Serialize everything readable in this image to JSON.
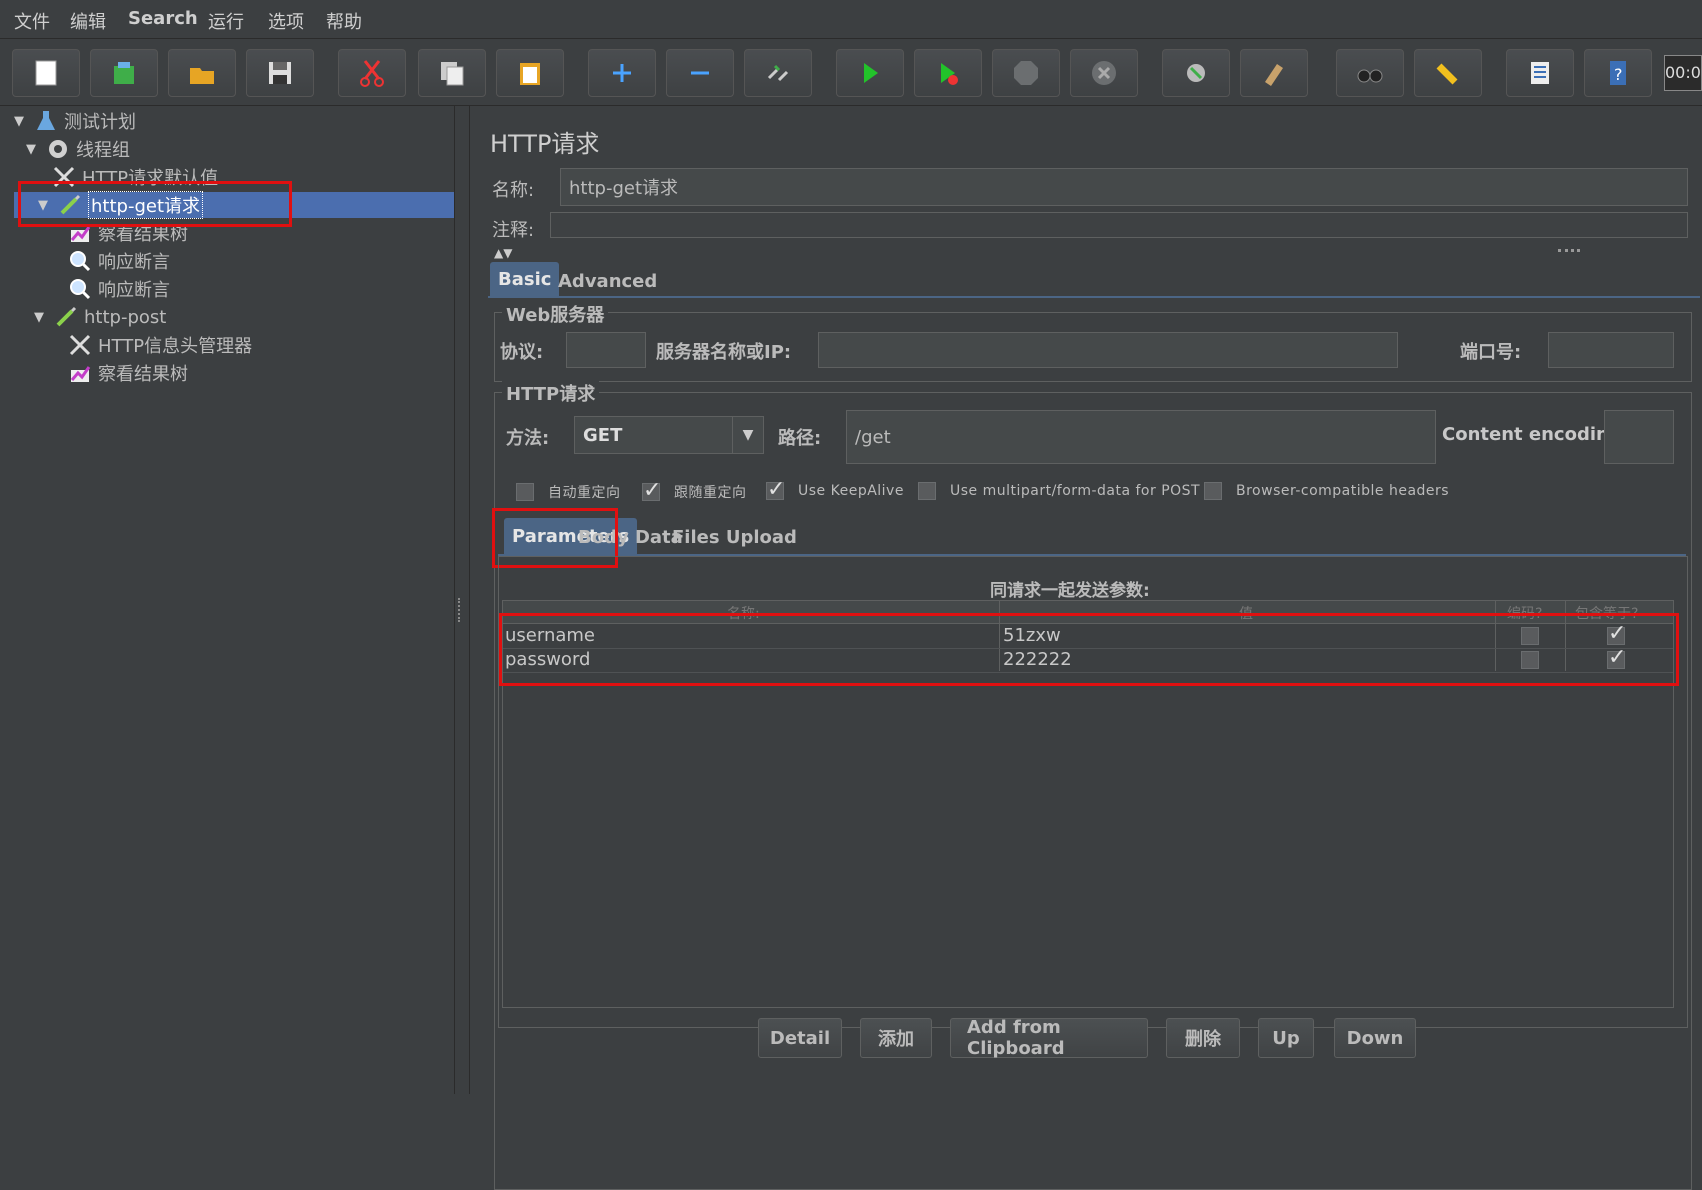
{
  "menu": [
    "文件",
    "编辑",
    "Search",
    "运行",
    "选项",
    "帮助"
  ],
  "toolbar": {
    "icons": [
      "new-icon",
      "templates-icon",
      "open-icon",
      "save-icon",
      "cut-icon",
      "copy-icon",
      "paste-icon",
      "expand-icon",
      "collapse-icon",
      "toggle-icon",
      "start-icon",
      "start-no-pause-icon",
      "stop-icon",
      "shutdown-icon",
      "clear-icon",
      "clear-all-icon",
      "search-icon",
      "reset-search-icon",
      "function-helper-icon",
      "help-icon"
    ],
    "timer": "00:0"
  },
  "tree": {
    "nodes": [
      {
        "label": "测试计划",
        "icon": "flask-icon"
      },
      {
        "label": "线程组",
        "icon": "gear-icon"
      },
      {
        "label": "HTTP请求默认值",
        "icon": "tools-icon"
      },
      {
        "label": "http-get请求",
        "icon": "pipette-icon"
      },
      {
        "label": "察看结果树",
        "icon": "chart-icon"
      },
      {
        "label": "响应断言",
        "icon": "magnifier-icon"
      },
      {
        "label": "响应断言",
        "icon": "magnifier-icon"
      },
      {
        "label": "http-post",
        "icon": "pipette-icon"
      },
      {
        "label": "HTTP信息头管理器",
        "icon": "tools-icon"
      },
      {
        "label": "察看结果树",
        "icon": "chart-icon"
      }
    ]
  },
  "panel": {
    "title": "HTTP请求",
    "name_label": "名称:",
    "name_value": "http-get请求",
    "comment_label": "注释:",
    "comment_value": "",
    "tabs": [
      "Basic",
      "Advanced"
    ],
    "web_server": {
      "title": "Web服务器",
      "protocol_label": "协议:",
      "protocol_value": "",
      "server_label": "服务器名称或IP:",
      "server_value": "",
      "port_label": "端口号:",
      "port_value": ""
    },
    "http_request": {
      "title": "HTTP请求",
      "method_label": "方法:",
      "method_value": "GET",
      "path_label": "路径:",
      "path_value": "/get",
      "encoding_label": "Content encoding:",
      "encoding_value": ""
    },
    "options": [
      {
        "label": "自动重定向",
        "checked": false
      },
      {
        "label": "跟随重定向",
        "checked": true
      },
      {
        "label": "Use KeepAlive",
        "checked": true
      },
      {
        "label": "Use multipart/form-data for POST",
        "checked": false
      },
      {
        "label": "Browser-compatible headers",
        "checked": false
      }
    ],
    "sub_tabs": [
      "Parameters",
      "Body Data",
      "Files Upload"
    ],
    "params_caption": "同请求一起发送参数:",
    "columns": [
      "名称:",
      "值",
      "编码?",
      "包含等于?"
    ],
    "rows": [
      {
        "name": "username",
        "value": "51zxw",
        "encode": false,
        "include_equals": true
      },
      {
        "name": "password",
        "value": "222222",
        "encode": false,
        "include_equals": true
      }
    ],
    "buttons": [
      "Detail",
      "添加",
      "Add from Clipboard",
      "删除",
      "Up",
      "Down"
    ]
  }
}
